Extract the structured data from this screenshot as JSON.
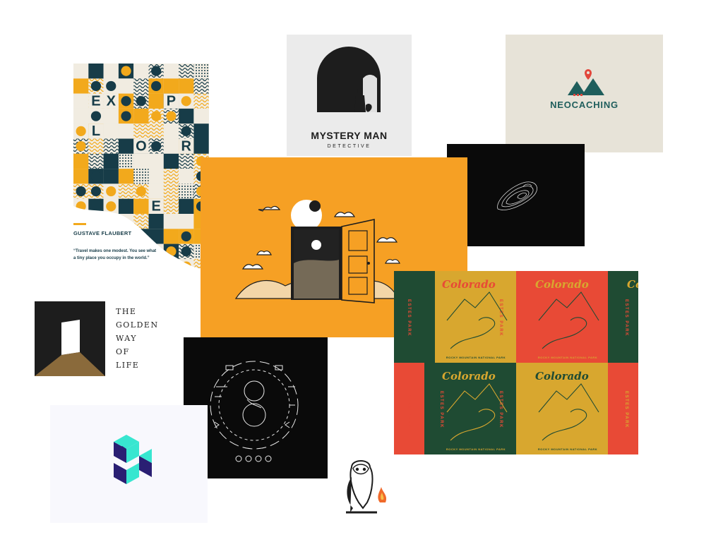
{
  "poster": {
    "letters": [
      "E",
      "X",
      "P",
      "L",
      "O",
      "R",
      "E"
    ],
    "author": "GUSTAVE FLAUBERT",
    "quote": "“Travel makes one modest. You see what a tiny place you occupy in the world.”",
    "colors": {
      "navy": "#173c48",
      "gold": "#f2a91c",
      "cream": "#f1ece1"
    }
  },
  "mystery": {
    "title": "MYSTERY MAN",
    "subtitle": "DETECTIVE"
  },
  "neocaching": {
    "title": "NEOCACHING",
    "colors": {
      "teal": "#1f5e5c",
      "red": "#e2463b"
    }
  },
  "colorado": {
    "word": "Colorado",
    "side_text": "ESTES PARK",
    "foot_text": "ROCKY MOUNTAIN NATIONAL PARK",
    "colors": {
      "red": "#e84a36",
      "gold": "#d8a72f",
      "green": "#1f4b33"
    }
  },
  "golden": {
    "lines": [
      "THE",
      "GOLDEN",
      "WAY",
      "OF",
      "LIFE"
    ],
    "colors": {
      "dark": "#1d1d1d",
      "brown": "#8a6a3b"
    }
  },
  "door": {
    "colors": {
      "background": "#f6a024",
      "ink": "#1d1d1d"
    }
  },
  "cube": {
    "colors": {
      "cyan": "#38e6d0",
      "indigo": "#2a1f73"
    }
  }
}
